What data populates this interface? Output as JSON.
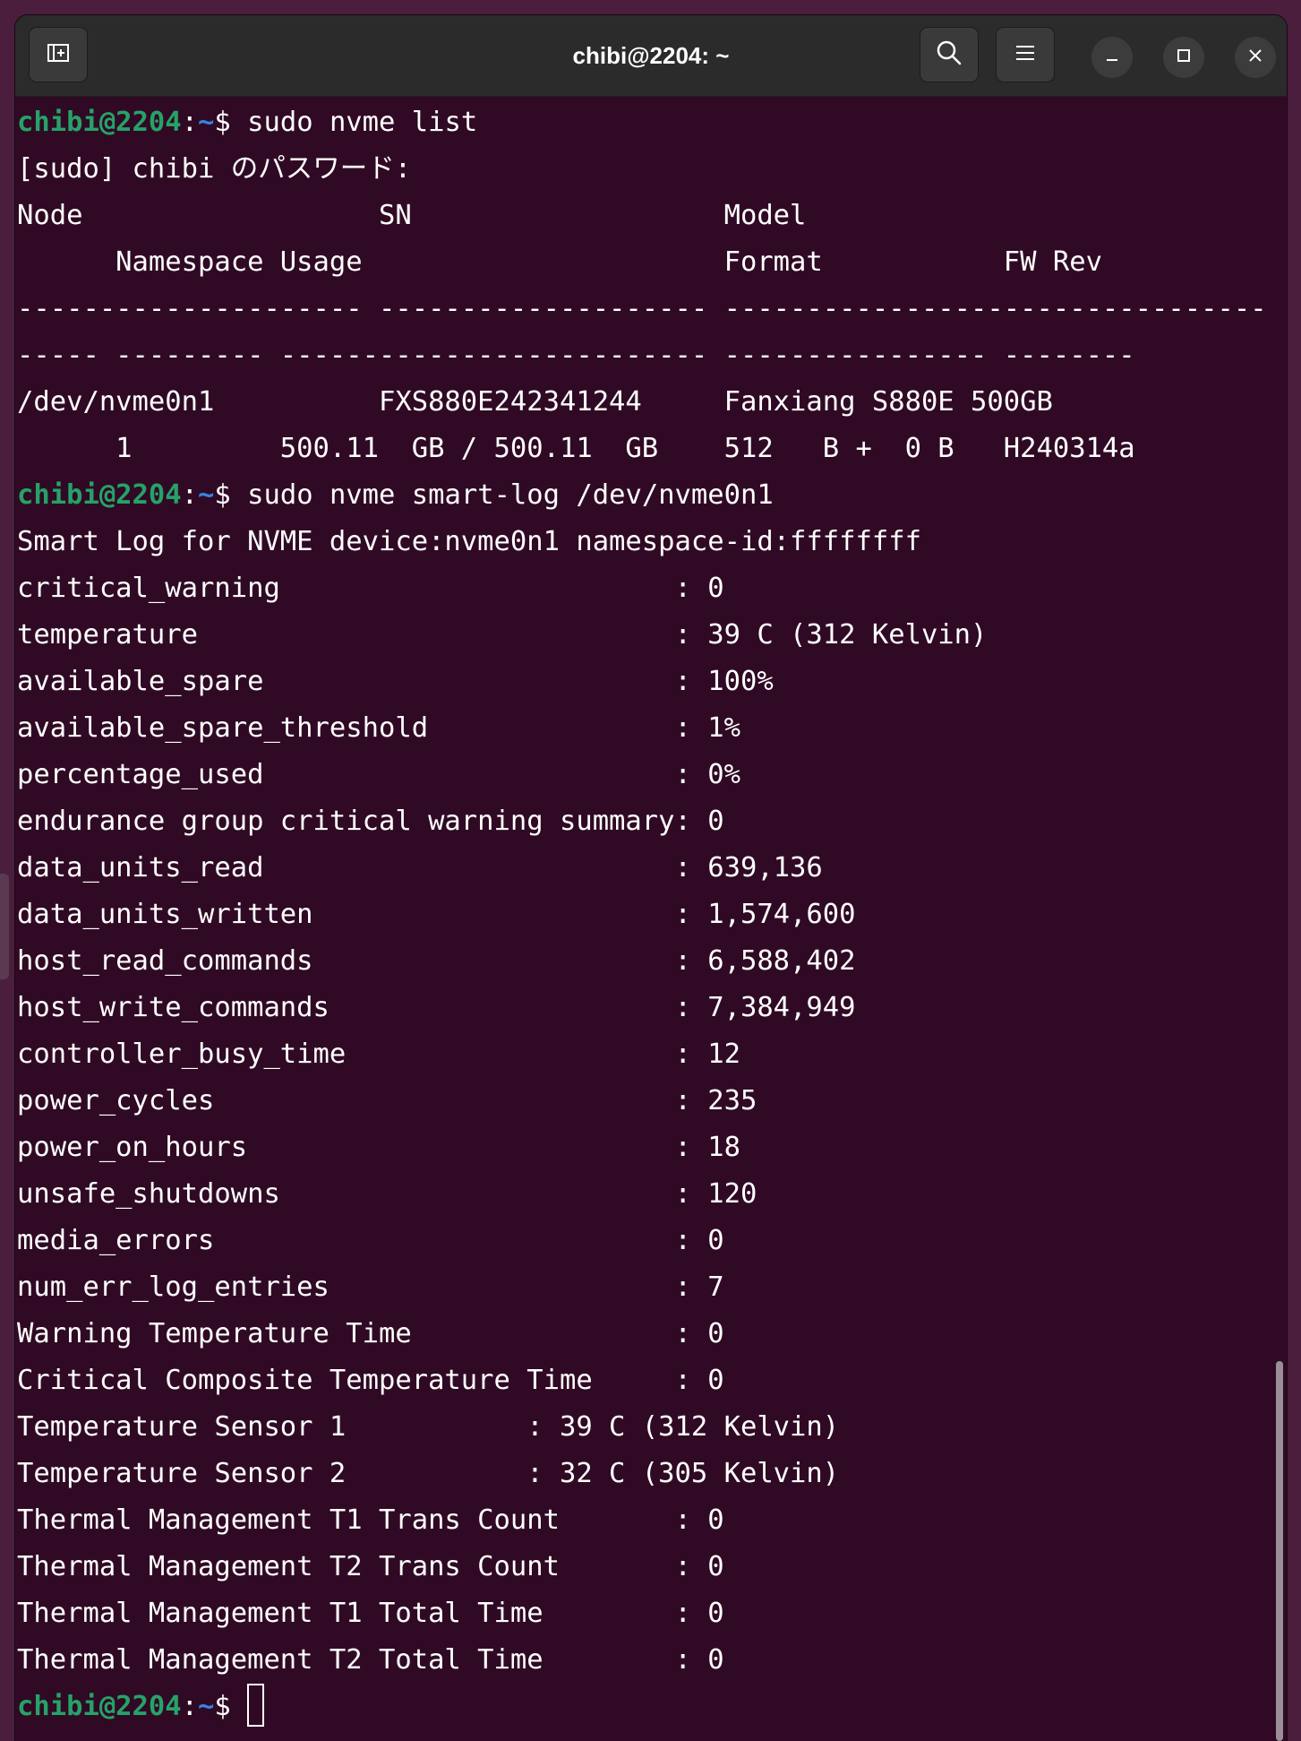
{
  "window": {
    "title": "chibi@2204: ~"
  },
  "toolbar": {
    "new_tab_icon": "new-tab-icon",
    "search_icon": "search-icon",
    "menu_icon": "hamburger-menu-icon",
    "minimize_icon": "minimize-icon",
    "maximize_icon": "maximize-icon",
    "close_icon": "close-icon"
  },
  "colors": {
    "terminal_bg": "#300a24",
    "prompt_user": "#26a269",
    "prompt_path": "#3584e4",
    "titlebar_bg": "#2b2b2b"
  },
  "terminal": {
    "prompt": {
      "user": "chibi@2204",
      "sep": ":",
      "path": "~",
      "symbol": "$ "
    },
    "lines": [
      {
        "type": "cmd",
        "text": "sudo nvme list"
      },
      {
        "type": "out",
        "text": "[sudo] chibi のパスワード:"
      },
      {
        "type": "out",
        "text": "Node                  SN                   Model"
      },
      {
        "type": "out",
        "text": "      Namespace Usage                      Format           FW Rev"
      },
      {
        "type": "out",
        "text": "--------------------- -------------------- ----------------------------------------"
      },
      {
        "type": "out",
        "text": "----- --------- -------------------------- ---------------- --------"
      },
      {
        "type": "out",
        "text": "/dev/nvme0n1          FXS880E242341244     Fanxiang S880E 500GB"
      },
      {
        "type": "out",
        "text": "      1         500.11  GB / 500.11  GB    512   B +  0 B   H240314a"
      },
      {
        "type": "cmd",
        "text": "sudo nvme smart-log /dev/nvme0n1"
      },
      {
        "type": "out",
        "text": "Smart Log for NVME device:nvme0n1 namespace-id:ffffffff"
      },
      {
        "type": "out",
        "text": "critical_warning                        : 0"
      },
      {
        "type": "out",
        "text": "temperature                             : 39 C (312 Kelvin)"
      },
      {
        "type": "out",
        "text": "available_spare                         : 100%"
      },
      {
        "type": "out",
        "text": "available_spare_threshold               : 1%"
      },
      {
        "type": "out",
        "text": "percentage_used                         : 0%"
      },
      {
        "type": "out",
        "text": "endurance group critical warning summary: 0"
      },
      {
        "type": "out",
        "text": "data_units_read                         : 639,136"
      },
      {
        "type": "out",
        "text": "data_units_written                      : 1,574,600"
      },
      {
        "type": "out",
        "text": "host_read_commands                      : 6,588,402"
      },
      {
        "type": "out",
        "text": "host_write_commands                     : 7,384,949"
      },
      {
        "type": "out",
        "text": "controller_busy_time                    : 12"
      },
      {
        "type": "out",
        "text": "power_cycles                            : 235"
      },
      {
        "type": "out",
        "text": "power_on_hours                          : 18"
      },
      {
        "type": "out",
        "text": "unsafe_shutdowns                        : 120"
      },
      {
        "type": "out",
        "text": "media_errors                            : 0"
      },
      {
        "type": "out",
        "text": "num_err_log_entries                     : 7"
      },
      {
        "type": "out",
        "text": "Warning Temperature Time                : 0"
      },
      {
        "type": "out",
        "text": "Critical Composite Temperature Time     : 0"
      },
      {
        "type": "out",
        "text": "Temperature Sensor 1           : 39 C (312 Kelvin)"
      },
      {
        "type": "out",
        "text": "Temperature Sensor 2           : 32 C (305 Kelvin)"
      },
      {
        "type": "out",
        "text": "Thermal Management T1 Trans Count       : 0"
      },
      {
        "type": "out",
        "text": "Thermal Management T2 Trans Count       : 0"
      },
      {
        "type": "out",
        "text": "Thermal Management T1 Total Time        : 0"
      },
      {
        "type": "out",
        "text": "Thermal Management T2 Total Time        : 0"
      },
      {
        "type": "cursor",
        "text": ""
      }
    ]
  }
}
